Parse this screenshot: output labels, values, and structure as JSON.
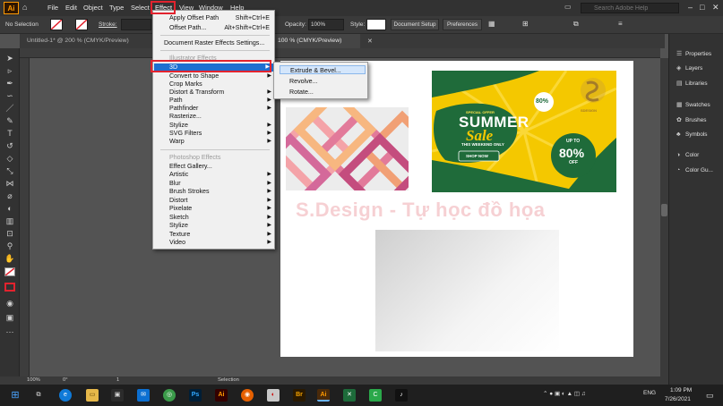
{
  "menubar": {
    "items": [
      "File",
      "Edit",
      "Object",
      "Type",
      "Select",
      "Effect",
      "View",
      "Window",
      "Help"
    ],
    "search_placeholder": "Search Adobe Help"
  },
  "control": {
    "selection": "No Selection",
    "stroke_label": "Stroke:",
    "opacity_label": "Opacity:",
    "opacity_value": "100%",
    "style_label": "Style:",
    "document_setup": "Document Setup",
    "preferences": "Preferences"
  },
  "tabs": {
    "tab1": "Untitled-1* @ 200 % (CMYK/Preview)",
    "tab2": "100 % (CMYK/Preview)"
  },
  "effect_menu": {
    "apply_offset": "Apply Offset Path",
    "apply_offset_sc": "Shift+Ctrl+E",
    "offset": "Offset Path...",
    "offset_sc": "Alt+Shift+Ctrl+E",
    "raster": "Document Raster Effects Settings...",
    "illustrator_hdr": "Illustrator Effects",
    "illustrator_items": [
      "3D",
      "Convert to Shape",
      "Crop Marks",
      "Distort & Transform",
      "Path",
      "Pathfinder",
      "Rasterize...",
      "Stylize",
      "SVG Filters",
      "Warp"
    ],
    "photoshop_hdr": "Photoshop Effects",
    "photoshop_items": [
      "Effect Gallery...",
      "Artistic",
      "Blur",
      "Brush Strokes",
      "Distort",
      "Pixelate",
      "Sketch",
      "Stylize",
      "Texture",
      "Video"
    ]
  },
  "submenu_3d": {
    "extrude": "Extrude & Bevel...",
    "revolve": "Revolve...",
    "rotate": "Rotate..."
  },
  "right_panel": {
    "items": [
      "Properties",
      "Layers",
      "Libraries",
      "Swatches",
      "Brushes",
      "Symbols",
      "Color",
      "Color Gu..."
    ]
  },
  "artwork": {
    "watermark": "S.Design - Tự học đồ họa",
    "banner_offer": "SPECIAL OFFER",
    "banner_title1": "SUMMER",
    "banner_title2": "Sale",
    "banner_weekend": "THIS WEEKEND ONLY",
    "banner_shop": "SHOP NOW",
    "banner_upto": "UP TO",
    "banner_pct": "80%",
    "banner_off": "OFF",
    "banner_badge": "80%",
    "banner_brand": "SDESIGN"
  },
  "status": {
    "zoom": "100%",
    "angle": "0°",
    "page": "1",
    "tool": "Selection"
  },
  "taskbar": {
    "lang": "ENG",
    "time": "1:09 PM",
    "date": "7/26/2021"
  },
  "colors": {
    "accent_red": "#e2232e",
    "menu_highlight": "#1e6fd0",
    "banner_yellow": "#f4c800",
    "banner_green": "#1f6b3a"
  }
}
